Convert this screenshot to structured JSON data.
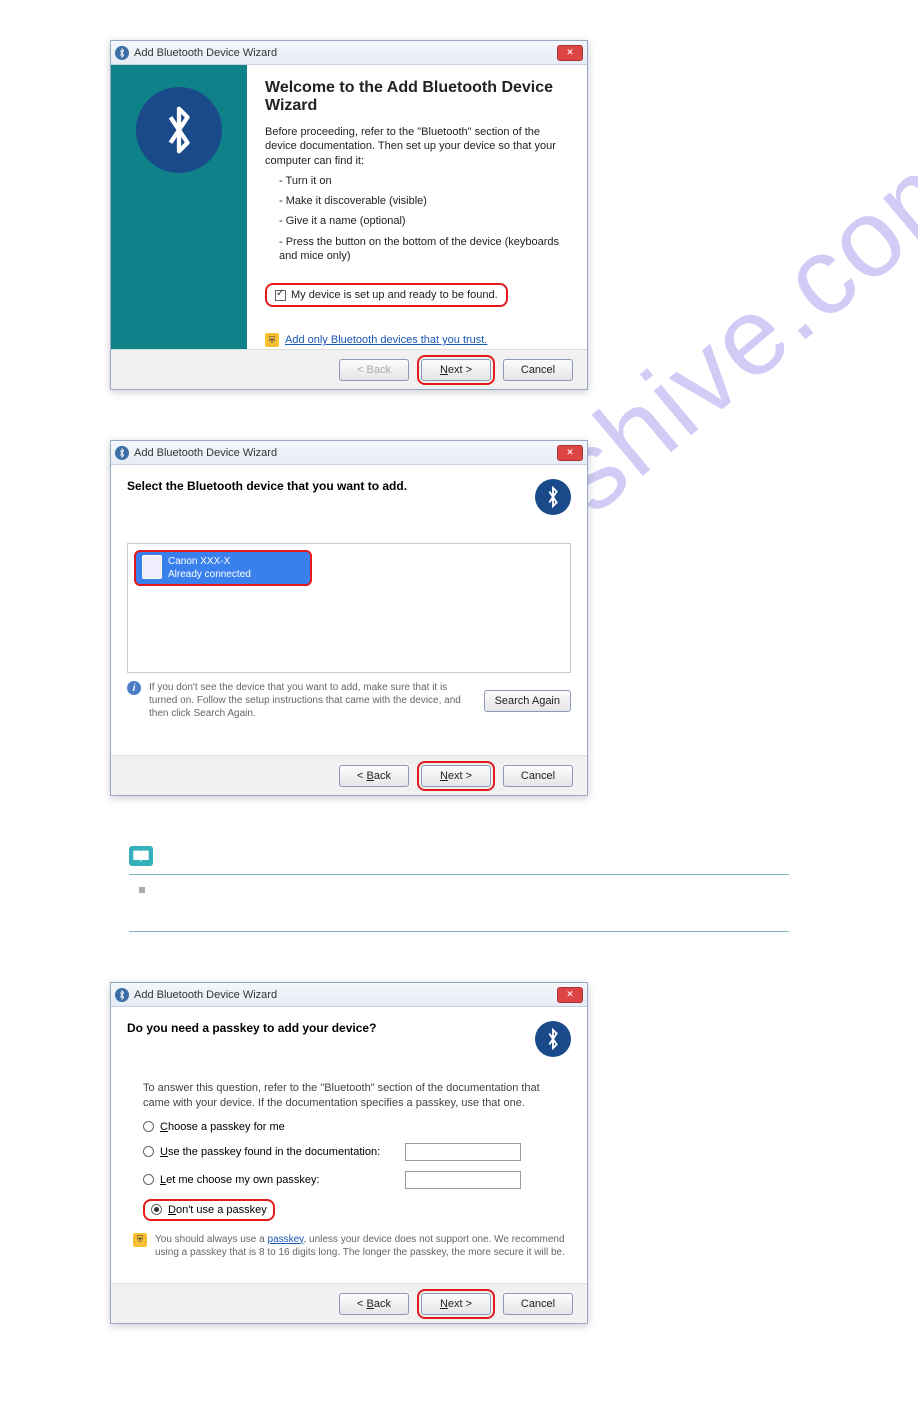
{
  "watermark": "manualshive.com",
  "dialog1": {
    "title": "Add Bluetooth Device Wizard",
    "heading": "Welcome to the Add Bluetooth Device Wizard",
    "intro": "Before proceeding, refer to the \"Bluetooth\" section of the device documentation. Then set up your device so that your computer can find it:",
    "bullets": [
      "- Turn it on",
      "- Make it discoverable (visible)",
      "- Give it a name (optional)",
      "- Press the button on the bottom of the device (keyboards and mice only)"
    ],
    "checkbox_label": "My device is set up and ready to be found.",
    "trust_link": "Add only Bluetooth devices that you trust.",
    "back": "< Back",
    "next": "Next >",
    "cancel": "Cancel"
  },
  "dialog2": {
    "title": "Add Bluetooth Device Wizard",
    "heading": "Select the Bluetooth device that you want to add.",
    "device_name": "Canon XXX-X",
    "device_status": "Already connected",
    "info": "If you don't see the device that you want to add, make sure that it is turned on. Follow the setup instructions that came with the device, and then click Search Again.",
    "search_again": "Search Again",
    "back": "< Back",
    "next": "Next >",
    "cancel": "Cancel"
  },
  "dialog3": {
    "title": "Add Bluetooth Device Wizard",
    "heading": "Do you need a passkey to add your device?",
    "intro": "To answer this question, refer to the \"Bluetooth\" section of the documentation that came with your device. If the documentation specifies a passkey, use that one.",
    "opt1": "Choose a passkey for me",
    "opt2": "Use the passkey found in the documentation:",
    "opt3": "Let me choose my own passkey:",
    "opt4": "Don't use a passkey",
    "note_prefix": "You should always use a ",
    "note_link": "passkey",
    "note_suffix": ", unless your device does not support one. We recommend using a passkey that is 8 to 16 digits long. The longer the passkey, the more secure it will be.",
    "back": "< Back",
    "next": "Next >",
    "cancel": "Cancel"
  }
}
